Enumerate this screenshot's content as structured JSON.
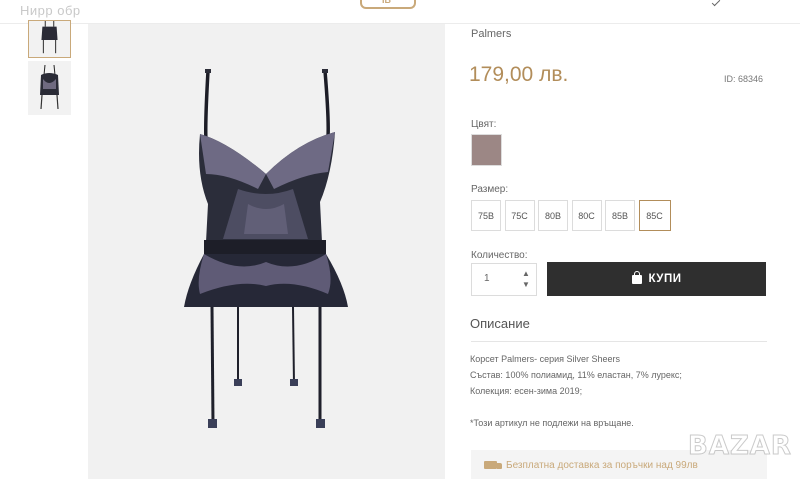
{
  "header": {
    "top_left_text": "Нирр обр",
    "logo_text": "IB"
  },
  "gallery": {
    "thumbnails": [
      "corset-front-thumbnail",
      "corset-back-thumbnail"
    ],
    "main_image": "black-lace-corset-image"
  },
  "product": {
    "brand": "Palmers",
    "price": "179,00 лв.",
    "id_label": "ID: 68346",
    "color_label": "Цвят:",
    "color_swatch_hex": "#9c8785",
    "size_label": "Размер:",
    "sizes": [
      {
        "label": "75B",
        "selected": false
      },
      {
        "label": "75C",
        "selected": false
      },
      {
        "label": "80B",
        "selected": false
      },
      {
        "label": "80C",
        "selected": false
      },
      {
        "label": "85B",
        "selected": false
      },
      {
        "label": "85C",
        "selected": true
      }
    ],
    "quantity_label": "Количество:",
    "quantity_value": "1",
    "buy_label": "КУПИ"
  },
  "description": {
    "heading": "Описание",
    "lines": [
      "Корсет Palmers- серия Silver Sheers",
      "Състав: 100% полиамид, 11% еластан, 7% лурекс;",
      "Колекция: есен-зима 2019;",
      "*Този артикул не подлежи на връщане."
    ]
  },
  "shipping": {
    "text": "Безплатна доставка за поръчки над 99лв",
    "icon": "truck-icon"
  },
  "watermark": "BAZAR",
  "colors": {
    "accent": "#b28d5a",
    "button_bg": "#2f2f2f",
    "image_bg": "#f1f1f1"
  }
}
